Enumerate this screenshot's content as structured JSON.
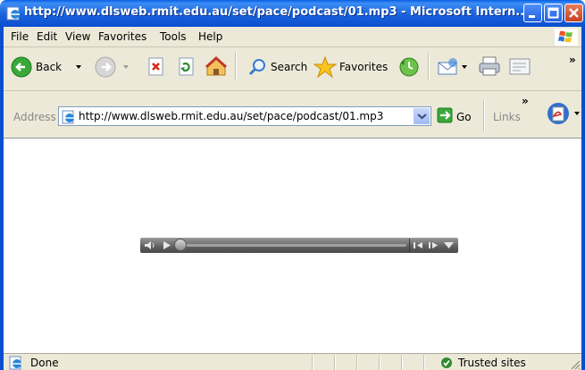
{
  "window": {
    "title": "http://www.dlsweb.rmit.edu.au/set/pace/podcast/01.mp3 - Microsoft Intern..."
  },
  "menu": {
    "items": [
      "File",
      "Edit",
      "View",
      "Favorites",
      "Tools",
      "Help"
    ]
  },
  "toolbar": {
    "back_label": "Back",
    "search_label": "Search",
    "favorites_label": "Favorites",
    "overflow_label": "»"
  },
  "address": {
    "label": "Address",
    "value": "http://www.dlsweb.rmit.edu.au/set/pace/podcast/01.mp3",
    "go_label": "Go",
    "links_label": "Links",
    "links_overflow": "»"
  },
  "media_player": {
    "position_fraction": 0.0
  },
  "status": {
    "text": "Done",
    "zone": "Trusted sites"
  },
  "colors": {
    "title_bar": "#0b4fd0",
    "chrome": "#ece9d8",
    "close_button": "#c8421f"
  }
}
